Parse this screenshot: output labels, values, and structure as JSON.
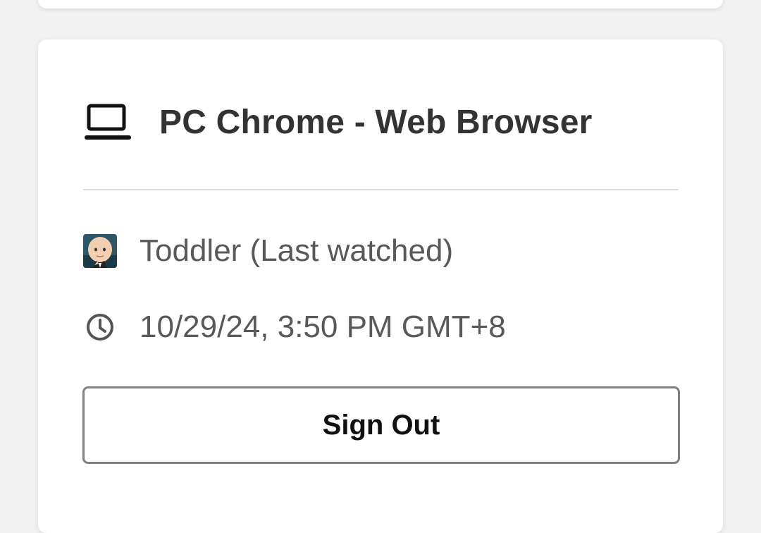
{
  "device": {
    "icon": "laptop-icon",
    "title": "PC Chrome - Web Browser"
  },
  "profile": {
    "avatar_icon": "profile-avatar",
    "label": "Toddler (Last watched)"
  },
  "last_activity": {
    "icon": "clock-icon",
    "timestamp": "10/29/24, 3:50 PM GMT+8"
  },
  "actions": {
    "sign_out_label": "Sign Out"
  },
  "colors": {
    "background": "#f2f2f2",
    "card": "#ffffff",
    "text_primary": "#333333",
    "text_secondary": "#595959",
    "divider": "#dedede",
    "button_border": "#808080"
  }
}
